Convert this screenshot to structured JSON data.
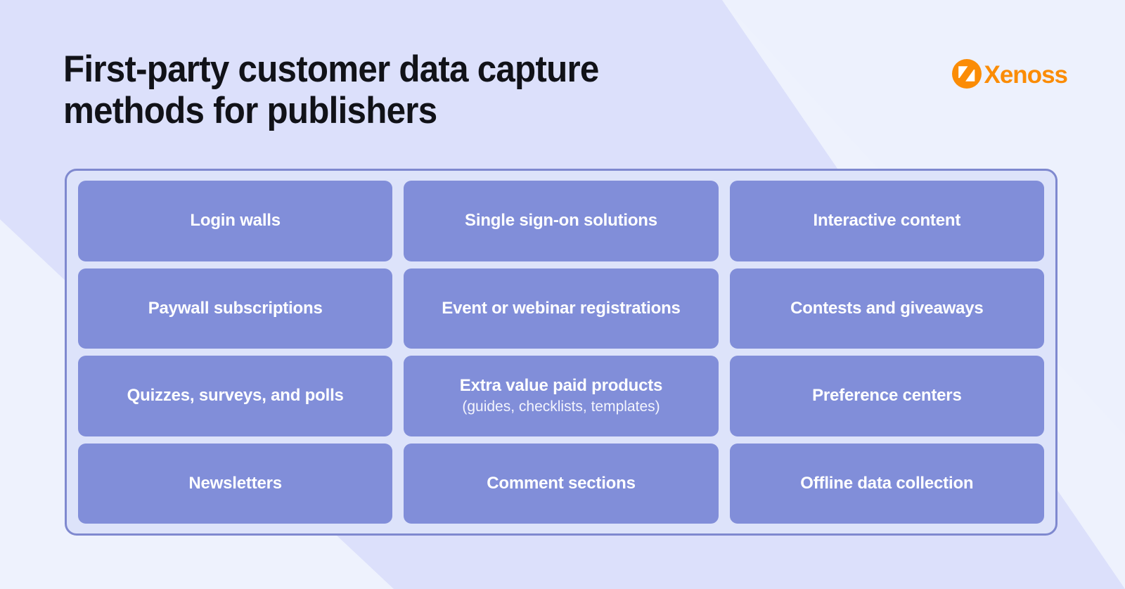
{
  "header": {
    "title": "First-party customer data capture\nmethods for publishers",
    "title_line_1": "First-party customer data capture",
    "title_line_2": "methods for publishers"
  },
  "logo": {
    "name": "Xenoss",
    "wordmark": "Xenoss",
    "mark_icon": "xenoss-circle-mark-icon",
    "color": "#FB8C05",
    "mark_inner_color": "#ffffff"
  },
  "colors": {
    "background_base": "#dce0fb",
    "background_light_wedge": "#eef2fd",
    "container_fill": "#dde3fa",
    "container_border": "#7f89cf",
    "card_fill": "#818ed9",
    "card_text": "#ffffff",
    "title_text": "#111218",
    "brand_orange": "#FB8C05"
  },
  "grid": {
    "columns": 3,
    "rows": 4,
    "cards": [
      {
        "title": "Login walls",
        "subtitle": ""
      },
      {
        "title": "Single sign-on solutions",
        "subtitle": ""
      },
      {
        "title": "Interactive content",
        "subtitle": ""
      },
      {
        "title": "Paywall subscriptions",
        "subtitle": ""
      },
      {
        "title": "Event or webinar registrations",
        "subtitle": ""
      },
      {
        "title": "Contests and giveaways",
        "subtitle": ""
      },
      {
        "title": "Quizzes, surveys, and polls",
        "subtitle": ""
      },
      {
        "title": "Extra value paid products",
        "subtitle": "(guides, checklists, templates)"
      },
      {
        "title": "Preference centers",
        "subtitle": ""
      },
      {
        "title": "Newsletters",
        "subtitle": ""
      },
      {
        "title": "Comment sections",
        "subtitle": ""
      },
      {
        "title": "Offline data collection",
        "subtitle": ""
      }
    ]
  }
}
